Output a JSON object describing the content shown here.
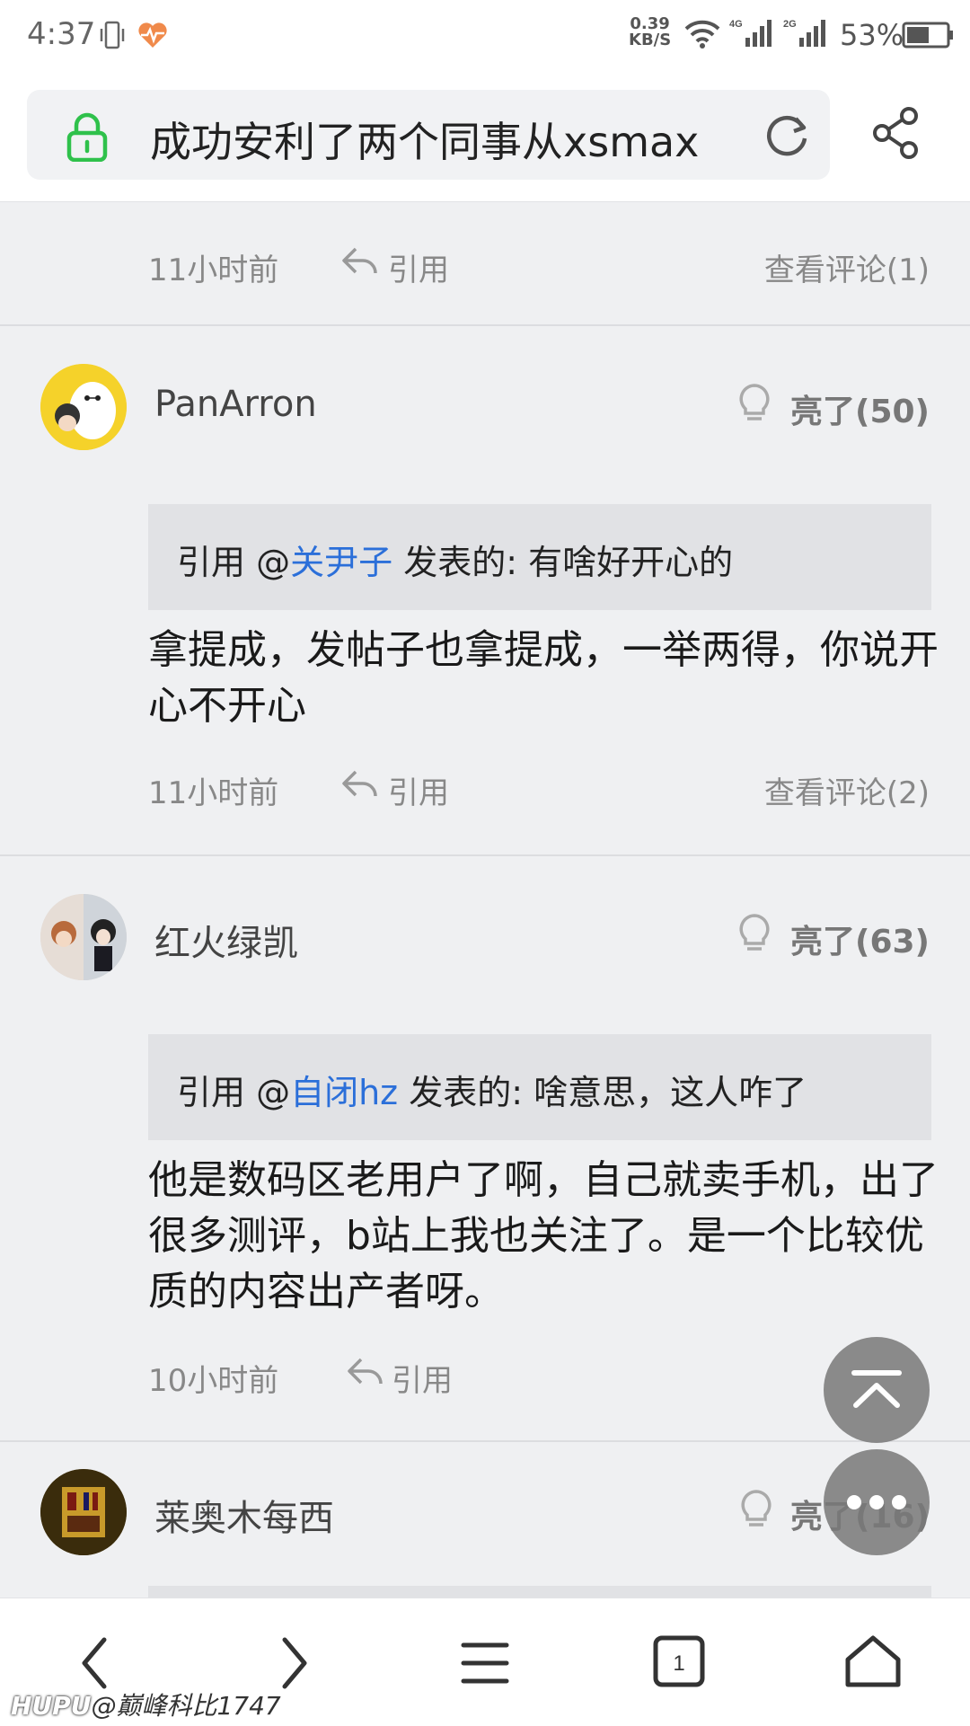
{
  "status_bar": {
    "time": "4:37",
    "speed_value": "0.39",
    "speed_unit": "KB/S",
    "net1": "4G",
    "net2": "2G",
    "battery": "53%"
  },
  "url_bar": {
    "title": "成功安利了两个同事从xsmax"
  },
  "posts": [
    {
      "time": "11小时前",
      "quote_label": "引用",
      "comments_label": "查看评论(1)"
    },
    {
      "username": "PanArron",
      "likes": "亮了(50)",
      "quote_prefix": "引用 @",
      "quote_user": "关尹子",
      "quote_suffix": " 发表的: 有啥好开心的",
      "body": "拿提成，发帖子也拿提成，一举两得，你说开心不开心",
      "time": "11小时前",
      "quote_label": "引用",
      "comments_label": "查看评论(2)"
    },
    {
      "username": "红火绿凯",
      "likes": "亮了(63)",
      "quote_prefix": "引用 @",
      "quote_user": "自闭hz",
      "quote_suffix": " 发表的: 啥意思，这人咋了",
      "body": "他是数码区老用户了啊，自己就卖手机，出了很多测评，b站上我也关注了。是一个比较优质的内容出产者呀。",
      "time": "10小时前",
      "quote_label": "引用"
    },
    {
      "username": "莱奥木每西",
      "likes": "亮了(16)"
    }
  ],
  "watermark": {
    "brand": "HUPU",
    "user": "@巅峰科比1747"
  },
  "icons": {
    "lock": "lock-icon",
    "reload": "reload-icon",
    "share": "share-icon",
    "bulb": "lightbulb-icon",
    "quote": "reply-arrow-icon",
    "back": "chevron-left-icon",
    "forward": "chevron-right-icon",
    "menu": "menu-icon",
    "tabs": "tabs-icon",
    "home": "home-icon"
  },
  "colors": {
    "accent_link": "#2b6fd9",
    "lock_green": "#2fc14b"
  }
}
